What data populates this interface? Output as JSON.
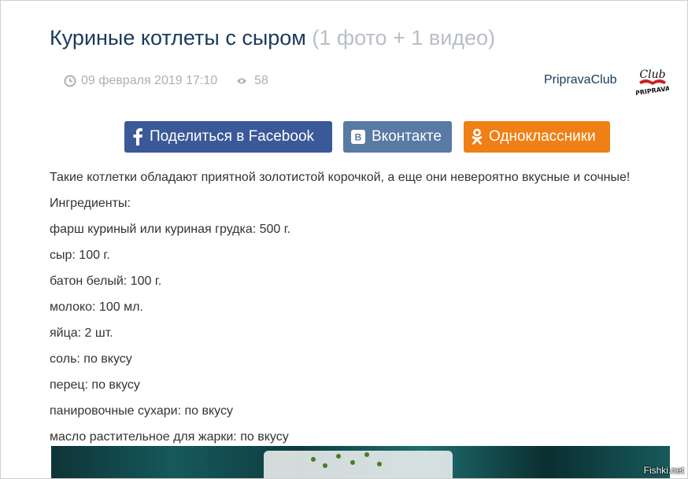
{
  "article": {
    "title": "Куриные котлеты с сыром",
    "title_suffix": "(1 фото + 1 видео)",
    "date": "09 февраля 2019 17:10",
    "views": "58",
    "author": "PripravaClub"
  },
  "share": {
    "facebook": "Поделиться в Facebook",
    "vkontakte": "Вконтакте",
    "odnoklassniki": "Одноклассники"
  },
  "content": {
    "intro": "Такие котлетки обладают приятной золотистой корочкой, а еще они невероятно вкусные и сочные!",
    "ingredients_heading": "Ингредиенты:",
    "ingredients": [
      "фарш куриный или куриная грудка: 500 г.",
      "сыр: 100 г.",
      "батон белый: 100 г.",
      "молоко: 100 мл.",
      "яйца: 2 шт.",
      "соль: по вкусу",
      "перец: по вкусу",
      "панировочные сухари: по вкусу",
      "масло растительное для жарки: по вкусу"
    ]
  },
  "watermark": "Fishki.net",
  "icons": {
    "date": "clock-icon",
    "views": "eye-icon",
    "facebook": "facebook-icon",
    "vkontakte": "vk-icon",
    "odnoklassniki": "odnoklassniki-icon"
  },
  "colors": {
    "title": "#1b3a5c",
    "muted": "#b9bec4",
    "facebook": "#3b5998",
    "vkontakte": "#587aa4",
    "odnoklassniki": "#f07f15"
  }
}
